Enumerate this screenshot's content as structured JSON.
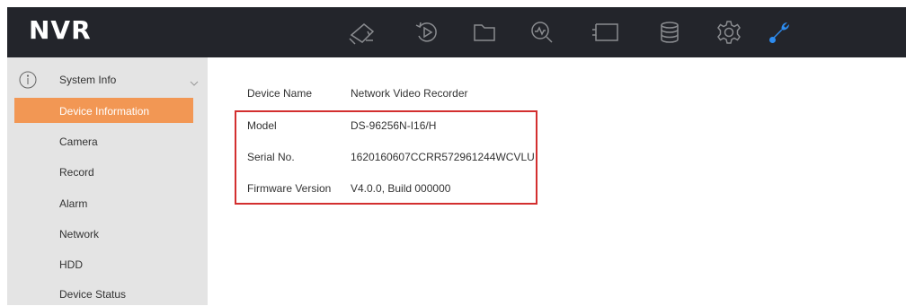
{
  "header": {
    "logo": "NVR",
    "nav_icons": [
      "live-view-icon",
      "playback-icon",
      "file-icon",
      "search-icon",
      "picture-icon",
      "storage-icon",
      "settings-icon",
      "maintenance-icon"
    ],
    "active_nav": "maintenance-icon",
    "colors": {
      "background": "#23252b",
      "icon": "#8a8c90",
      "active_icon": "#2d8cf0"
    }
  },
  "sidebar": {
    "group_label": "System Info",
    "items": [
      {
        "label": "Device Information",
        "active": true
      },
      {
        "label": "Camera"
      },
      {
        "label": "Record"
      },
      {
        "label": "Alarm"
      },
      {
        "label": "Network"
      },
      {
        "label": "HDD"
      },
      {
        "label": "Device Status"
      }
    ],
    "colors": {
      "active_background": "#f29754",
      "panel_background": "#e4e4e4"
    }
  },
  "details": {
    "rows": [
      {
        "label": "Device Name",
        "value": "Network Video Recorder"
      },
      {
        "label": "Model",
        "value": "DS-96256N-I16/H"
      },
      {
        "label": "Serial No.",
        "value": "1620160607CCRR572961244WCVLU"
      },
      {
        "label": "Firmware Version",
        "value": "V4.0.0, Build 000000"
      }
    ],
    "highlight_color": "#d32f2f"
  }
}
